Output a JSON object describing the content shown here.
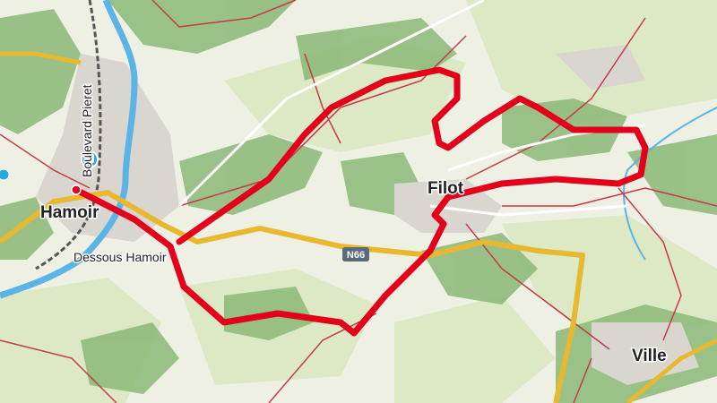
{
  "labels": {
    "hamoir": "Hamoir",
    "dessous_hamoir": "Dessous Hamoir",
    "filot": "Filot",
    "ville": "Ville",
    "boulevard": "Boulevard Pieret"
  },
  "road_shield": "N66",
  "colors": {
    "route": "#e3001b",
    "main_road": "#e8b830",
    "minor_road": "#c43a4a",
    "river": "#5ab4e6",
    "forest": "#7fae6a",
    "meadow": "#dbe7c2",
    "railway": "#555555",
    "transit_badge": "#27a8e0"
  },
  "icons": {
    "transit": "bus-stop-icon",
    "start": "route-start-icon"
  }
}
